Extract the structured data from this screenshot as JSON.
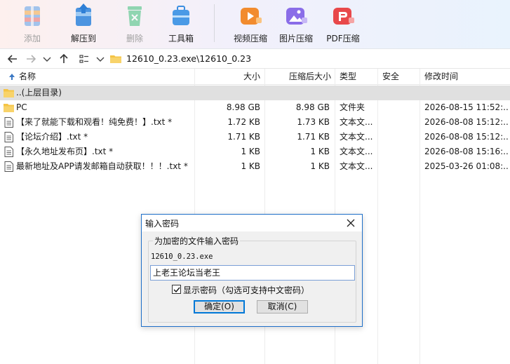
{
  "toolbar": {
    "add": "添加",
    "extract": "解压到",
    "delete": "删除",
    "tools": "工具箱",
    "video": "视频压缩",
    "image": "图片压缩",
    "pdf": "PDF压缩"
  },
  "address": {
    "path": "12610_0.23.exe\\12610_0.23"
  },
  "columns": {
    "name": "名称",
    "size": "大小",
    "packed": "压缩后大小",
    "type": "类型",
    "security": "安全",
    "modified": "修改时间"
  },
  "files": [
    {
      "name": "..(上层目录)",
      "size": "",
      "packed": "",
      "type": "",
      "modified": "",
      "icon": "folder-up-icon"
    },
    {
      "name": "PC",
      "size": "8.98 GB",
      "packed": "8.98 GB",
      "type": "文件夹",
      "modified": "2026-08-15 11:52:...",
      "icon": "folder-icon"
    },
    {
      "name": "【来了就能下载和观看！纯免费！】.txt *",
      "size": "1.72 KB",
      "packed": "1.73 KB",
      "type": "文本文...",
      "modified": "2026-08-08 15:12:...",
      "icon": "text-file-icon"
    },
    {
      "name": "【论坛介绍】.txt *",
      "size": "1.71 KB",
      "packed": "1.71 KB",
      "type": "文本文...",
      "modified": "2026-08-08 15:12:...",
      "icon": "text-file-icon"
    },
    {
      "name": "【永久地址发布页】.txt *",
      "size": "1 KB",
      "packed": "1 KB",
      "type": "文本文...",
      "modified": "2026-08-08 15:16:...",
      "icon": "text-file-icon"
    },
    {
      "name": "最新地址及APP请发邮箱自动获取！！！.txt *",
      "size": "1 KB",
      "packed": "1 KB",
      "type": "文本文...",
      "modified": "2025-03-26 01:08:...",
      "icon": "text-file-icon"
    }
  ],
  "dialog": {
    "title": "输入密码",
    "group_label": "为加密的文件输入密码",
    "filename": "12610_0.23.exe",
    "password": "上老王论坛当老王",
    "show_password_label": "显示密码（勾选可支持中文密码）",
    "show_password_checked": true,
    "ok_label": "确定(O)",
    "cancel_label": "取消(C)"
  }
}
